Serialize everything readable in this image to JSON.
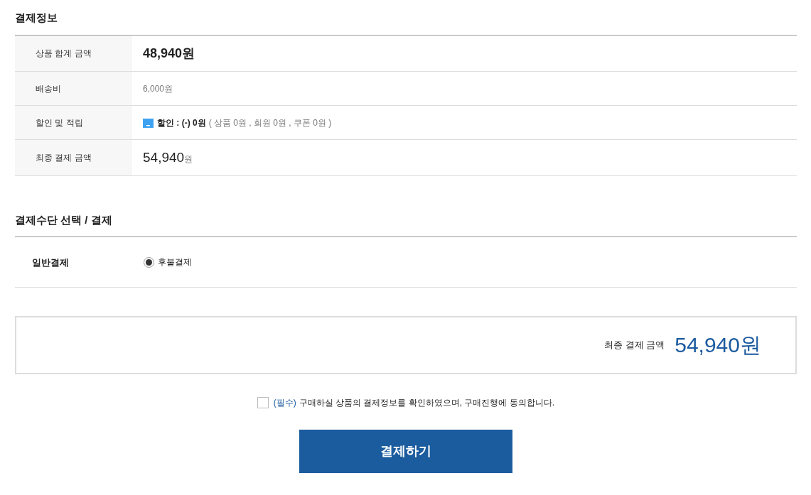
{
  "payment_info": {
    "title": "결제정보",
    "rows": [
      {
        "kind": "total",
        "label": "상품 합계 금액",
        "value": "48,940원"
      },
      {
        "kind": "fee",
        "label": "배송비",
        "value": "6,000원"
      },
      {
        "kind": "discount",
        "label": "할인 및 적립",
        "summary": "할인 : (-) 0원",
        "breakdown": "( 상품 0원 , 회원 0원 , 쿠폰 0원 )"
      },
      {
        "kind": "final",
        "label": "최종 결제 금액",
        "value": "54,940",
        "unit": "원"
      }
    ]
  },
  "payment_method": {
    "title": "결제수단 선택 / 결제",
    "label": "일반결제",
    "options": [
      {
        "label": "후불결제",
        "selected": true
      }
    ]
  },
  "final_summary": {
    "label": "최종 결제 금액",
    "amount": "54,940원"
  },
  "agreement": {
    "checked": false,
    "required_tag": "(필수)",
    "text": "구매하실 상품의 결제정보를 확인하였으며, 구매진행에 동의합니다."
  },
  "pay_button": {
    "label": "결제하기"
  }
}
